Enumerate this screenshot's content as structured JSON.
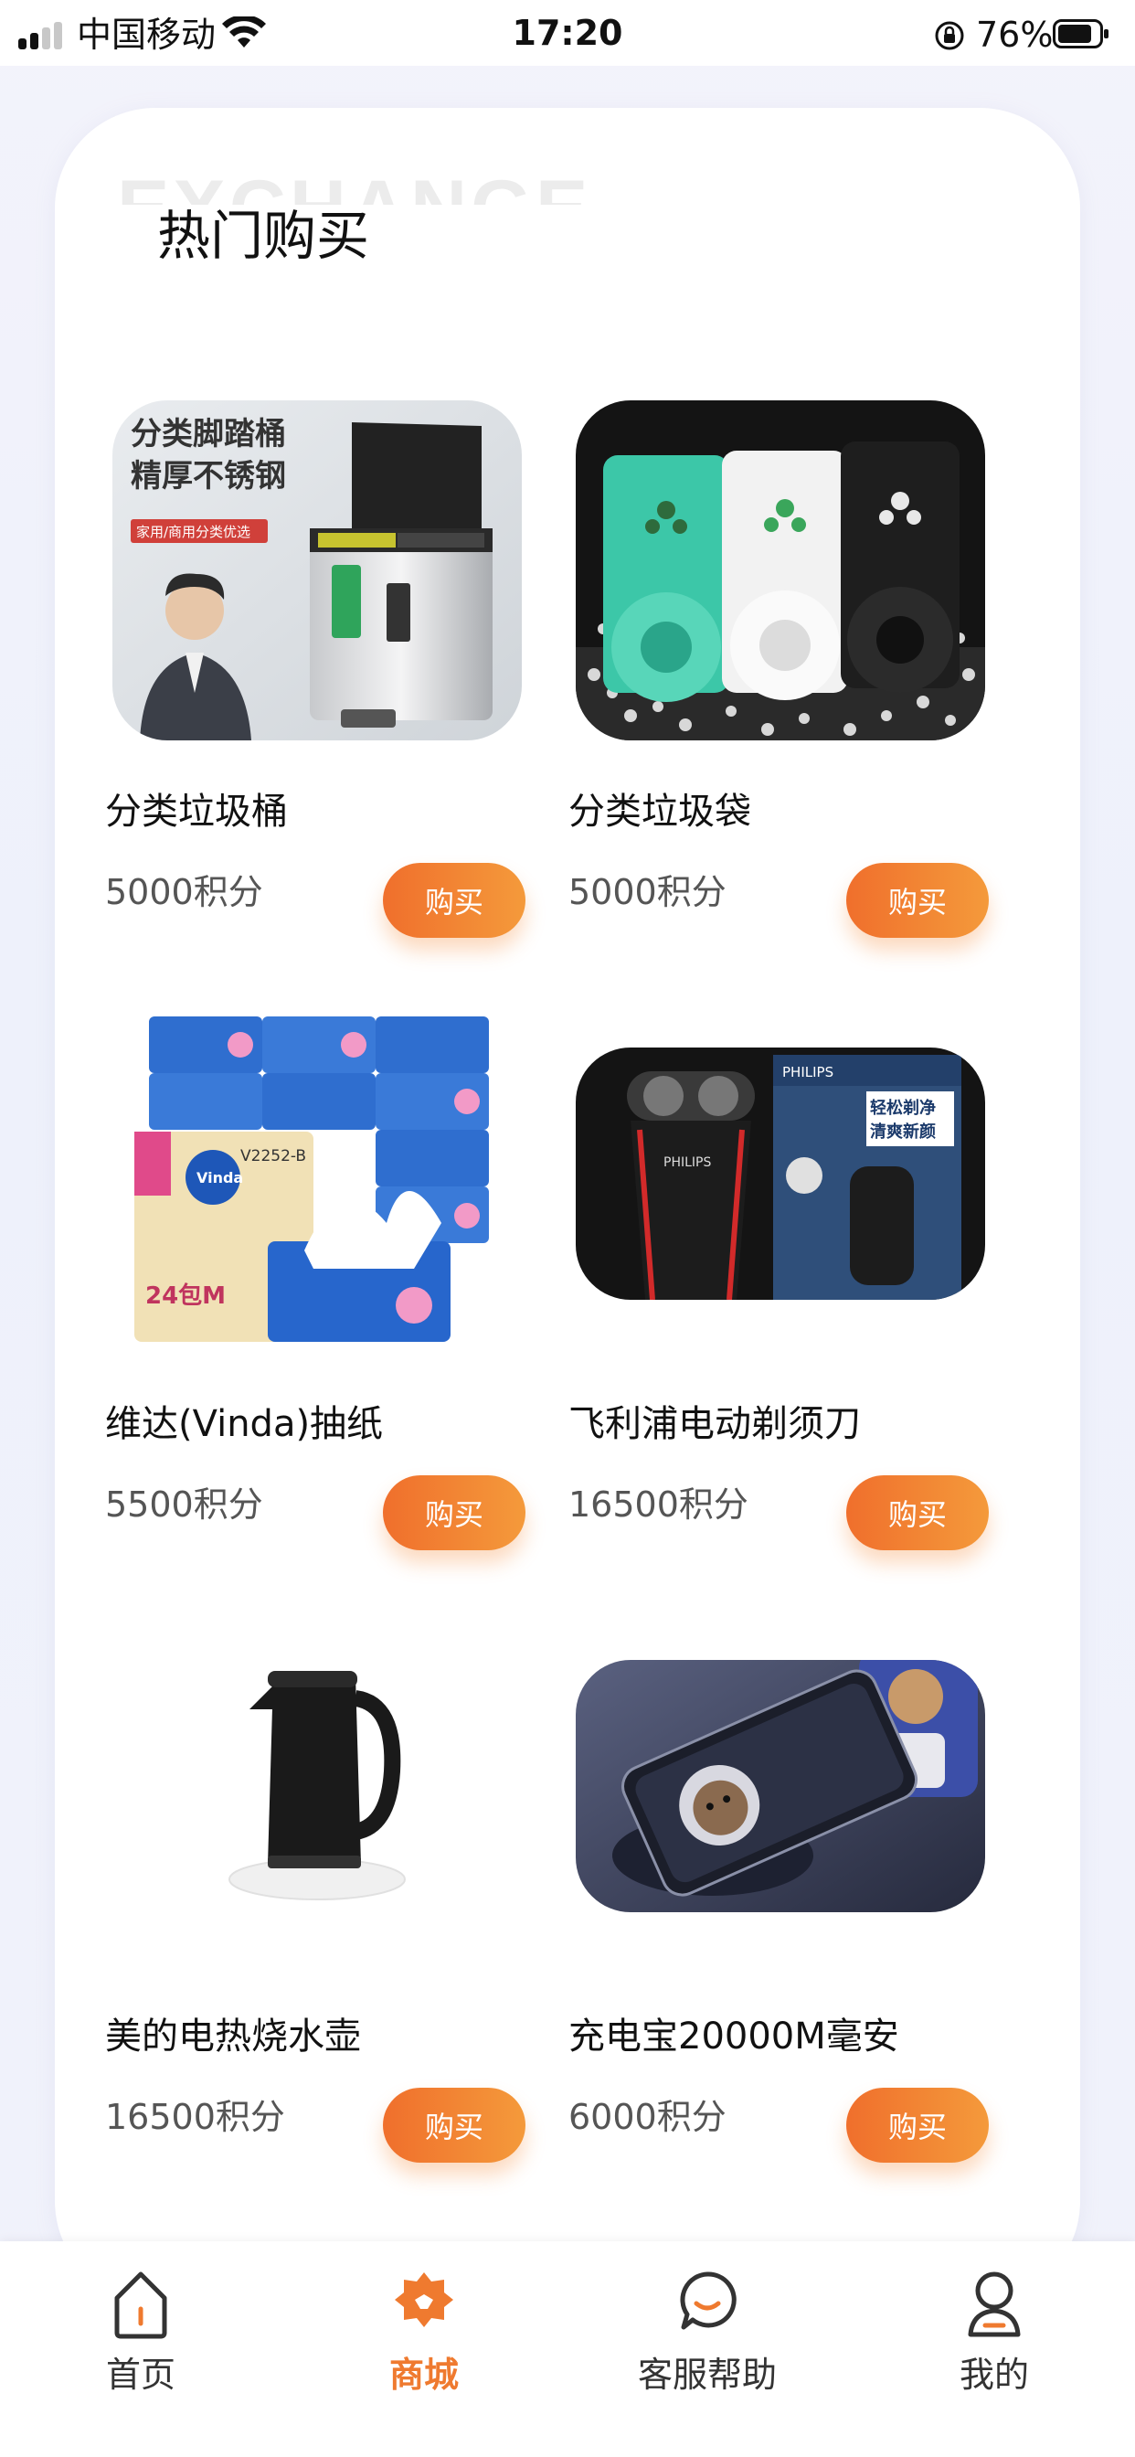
{
  "status_bar": {
    "carrier": "中国移动",
    "time": "17:20",
    "battery": "76%"
  },
  "section": {
    "title": "热门购买",
    "watermark": "EXCHANGE"
  },
  "buy_label": "购买",
  "products": [
    {
      "name": "分类垃圾桶",
      "price": "5000积分",
      "image": "classification-trash-bin"
    },
    {
      "name": "分类垃圾袋",
      "price": "5000积分",
      "image": "garbage-bag-rolls"
    },
    {
      "name": "维达(Vinda)抽纸",
      "price": "5500积分",
      "image": "vinda-tissue-packs"
    },
    {
      "name": "飞利浦电动剃须刀",
      "price": "16500积分",
      "image": "philips-shaver"
    },
    {
      "name": "美的电热烧水壶",
      "price": "16500积分",
      "image": "electric-kettle"
    },
    {
      "name": "充电宝20000M毫安",
      "price": "6000积分",
      "image": "power-bank"
    }
  ],
  "product_image_text": {
    "trash_line1": "分类脚踏桶",
    "trash_line2": "精厚不锈钢",
    "trash_tag": "家用/商用分类优选",
    "shaver_brand": "PHILIPS",
    "shaver_box_line1": "轻松剃净",
    "shaver_box_line2": "清爽新颜",
    "tissue_brand": "Vinda",
    "tissue_model": "V2252-B",
    "tissue_size": "24包M"
  },
  "tab_bar": {
    "tabs": [
      {
        "label": "首页",
        "icon": "home-icon",
        "active": false
      },
      {
        "label": "商城",
        "icon": "shop-icon",
        "active": true
      },
      {
        "label": "客服帮助",
        "icon": "chat-bubble-icon",
        "active": false
      },
      {
        "label": "我的",
        "icon": "user-icon",
        "active": false
      }
    ]
  },
  "colors": {
    "accent": "#EF7A2F",
    "button_gradient_start": "#F06F2C",
    "button_gradient_end": "#F49A3B",
    "price_text": "#555555",
    "background": "#F1F2FB"
  }
}
